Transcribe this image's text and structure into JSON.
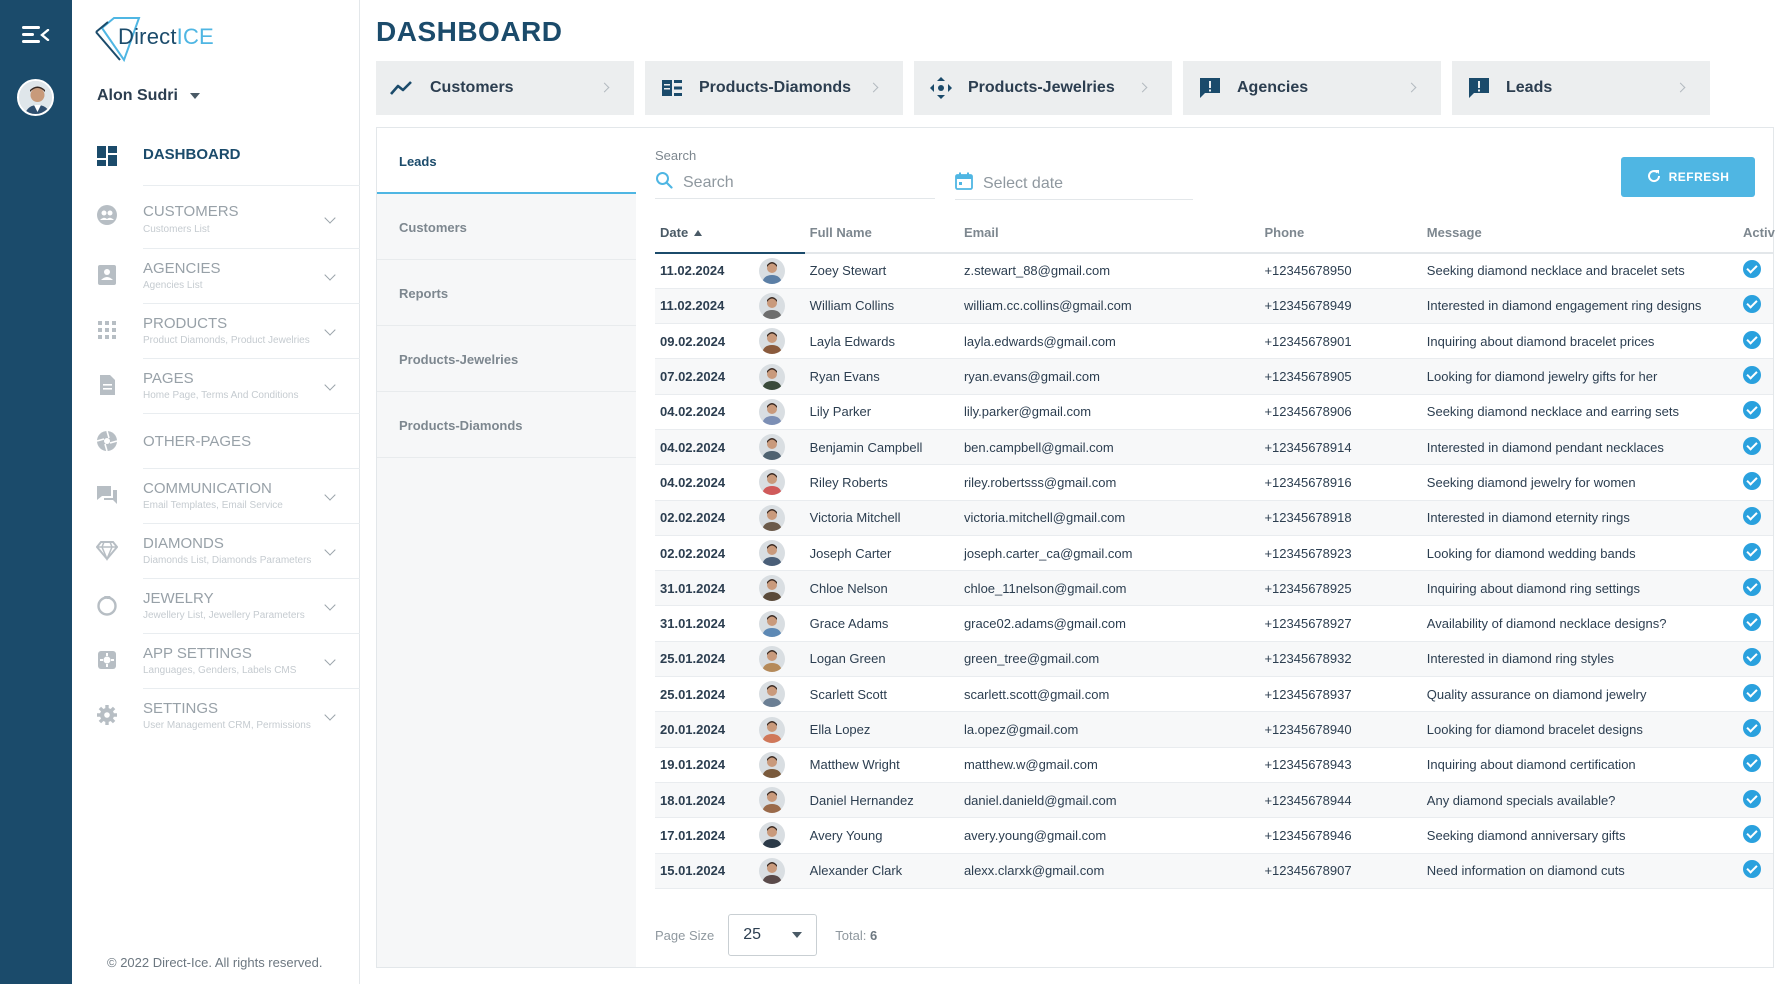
{
  "brand": {
    "logo_left": "Direct",
    "logo_right": "ICE"
  },
  "user": {
    "name": "Alon Sudri"
  },
  "nav": [
    {
      "label": "DASHBOARD",
      "sub": "",
      "icon": "dashboard-icon",
      "active": true
    },
    {
      "label": "CUSTOMERS",
      "sub": "Customers List",
      "icon": "customers-icon"
    },
    {
      "label": "AGENCIES",
      "sub": "Agencies List",
      "icon": "agencies-icon"
    },
    {
      "label": "PRODUCTS",
      "sub": "Product Diamonds, Product Jewelries",
      "icon": "products-icon"
    },
    {
      "label": "PAGES",
      "sub": "Home Page, Terms And Conditions",
      "icon": "pages-icon"
    },
    {
      "label": "OTHER-PAGES",
      "sub": "",
      "icon": "other-pages-icon"
    },
    {
      "label": "COMMUNICATION",
      "sub": "Email Templates, Email Service",
      "icon": "communication-icon"
    },
    {
      "label": "DIAMONDS",
      "sub": "Diamonds List, Diamonds Parameters",
      "icon": "diamond-icon"
    },
    {
      "label": "JEWELRY",
      "sub": "Jewellery List, Jewellery Parameters",
      "icon": "jewelry-icon"
    },
    {
      "label": "APP SETTINGS",
      "sub": "Languages, Genders, Labels CMS",
      "icon": "app-settings-icon"
    },
    {
      "label": "SETTINGS",
      "sub": "User Management CRM, Permissions",
      "icon": "settings-icon"
    }
  ],
  "copyright": "© 2022 Direct-Ice. All rights reserved.",
  "page_title": "DASHBOARD",
  "cards": [
    {
      "label": "Customers",
      "icon": "trend-icon"
    },
    {
      "label": "Products-Diamonds",
      "icon": "list-icon"
    },
    {
      "label": "Products-Jewelries",
      "icon": "move-icon"
    },
    {
      "label": "Agencies",
      "icon": "alert-icon"
    },
    {
      "label": "Leads",
      "icon": "alert-icon"
    }
  ],
  "tabs": [
    "Leads",
    "Customers",
    "Reports",
    "Products-Jewelries",
    "Products-Diamonds"
  ],
  "search": {
    "label": "Search",
    "placeholder": "Search"
  },
  "date_picker": {
    "placeholder": "Select date"
  },
  "refresh_label": "REFRESH",
  "table": {
    "columns": [
      "Date",
      "",
      "Full Name",
      "Email",
      "Phone",
      "Message",
      "Activ"
    ],
    "rows": [
      {
        "date": "11.02.2024",
        "name": "Zoey Stewart",
        "email": "z.stewart_88@gmail.com",
        "phone": "+12345678950",
        "message": "Seeking diamond necklace and bracelet sets",
        "avatar_color": "#5b7fa6"
      },
      {
        "date": "11.02.2024",
        "name": "William Collins",
        "email": "william.cc.collins@gmail.com",
        "phone": "+12345678949",
        "message": "Interested in diamond engagement ring designs",
        "avatar_color": "#6d6d6d"
      },
      {
        "date": "09.02.2024",
        "name": "Layla Edwards",
        "email": "layla.edwards@gmail.com",
        "phone": "+12345678901",
        "message": "Inquiring about diamond bracelet prices",
        "avatar_color": "#8a5a3c"
      },
      {
        "date": "07.02.2024",
        "name": "Ryan Evans",
        "email": "ryan.evans@gmail.com",
        "phone": "+12345678905",
        "message": "Looking for diamond jewelry gifts for her",
        "avatar_color": "#3a4a3a"
      },
      {
        "date": "04.02.2024",
        "name": "Lily Parker",
        "email": "lily.parker@gmail.com",
        "phone": "+12345678906",
        "message": "Seeking diamond necklace and earring sets",
        "avatar_color": "#7c8fb5"
      },
      {
        "date": "04.02.2024",
        "name": "Benjamin Campbell",
        "email": "ben.campbell@gmail.com",
        "phone": "+12345678914",
        "message": "Interested in diamond pendant necklaces",
        "avatar_color": "#4f6270"
      },
      {
        "date": "04.02.2024",
        "name": "Riley Roberts",
        "email": "riley.robertsss@gmail.com",
        "phone": "+12345678916",
        "message": "Seeking diamond jewelry for women",
        "avatar_color": "#d05a5a"
      },
      {
        "date": "02.02.2024",
        "name": "Victoria Mitchell",
        "email": "victoria.mitchell@gmail.com",
        "phone": "+12345678918",
        "message": "Interested in diamond eternity rings",
        "avatar_color": "#6b5a4a"
      },
      {
        "date": "02.02.2024",
        "name": "Joseph Carter",
        "email": "joseph.carter_ca@gmail.com",
        "phone": "+12345678923",
        "message": "Looking for diamond wedding bands",
        "avatar_color": "#4a5f78"
      },
      {
        "date": "31.01.2024",
        "name": "Chloe Nelson",
        "email": "chloe_11nelson@gmail.com",
        "phone": "+12345678925",
        "message": "Inquiring about diamond ring settings",
        "avatar_color": "#5a4a3a"
      },
      {
        "date": "31.01.2024",
        "name": "Grace Adams",
        "email": "grace02.adams@gmail.com",
        "phone": "+12345678927",
        "message": "Availability of diamond necklace designs?",
        "avatar_color": "#5d89b5"
      },
      {
        "date": "25.01.2024",
        "name": "Logan Green",
        "email": "green_tree@gmail.com",
        "phone": "+12345678932",
        "message": "Interested in diamond ring styles",
        "avatar_color": "#b58a5a"
      },
      {
        "date": "25.01.2024",
        "name": "Scarlett Scott",
        "email": "scarlett.scott@gmail.com",
        "phone": "+12345678937",
        "message": "Quality assurance on diamond jewelry",
        "avatar_color": "#6b7f94"
      },
      {
        "date": "20.01.2024",
        "name": "Ella Lopez",
        "email": "la.opez@gmail.com",
        "phone": "+12345678940",
        "message": "Looking for diamond bracelet designs",
        "avatar_color": "#d0785a"
      },
      {
        "date": "19.01.2024",
        "name": "Matthew Wright",
        "email": "matthew.w@gmail.com",
        "phone": "+12345678943",
        "message": "Inquiring about diamond certification",
        "avatar_color": "#7a5a3c"
      },
      {
        "date": "18.01.2024",
        "name": "Daniel Hernandez",
        "email": "daniel.danield@gmail.com",
        "phone": "+12345678944",
        "message": "Any diamond specials available?",
        "avatar_color": "#9a6a4a"
      },
      {
        "date": "17.01.2024",
        "name": "Avery Young",
        "email": "avery.young@gmail.com",
        "phone": "+12345678946",
        "message": "Seeking diamond anniversary gifts",
        "avatar_color": "#2c3a48"
      },
      {
        "date": "15.01.2024",
        "name": "Alexander Clark",
        "email": "alexx.clarxk@gmail.com",
        "phone": "+12345678907",
        "message": "Need information on diamond cuts",
        "avatar_color": "#5a4a4a"
      }
    ]
  },
  "footer": {
    "page_size_label": "Page Size",
    "page_size_value": "25",
    "total_label": "Total:",
    "total_value": "6"
  },
  "colors": {
    "primary": "#1b4b6b",
    "accent": "#4fb6e3",
    "check": "#2aa1de"
  }
}
